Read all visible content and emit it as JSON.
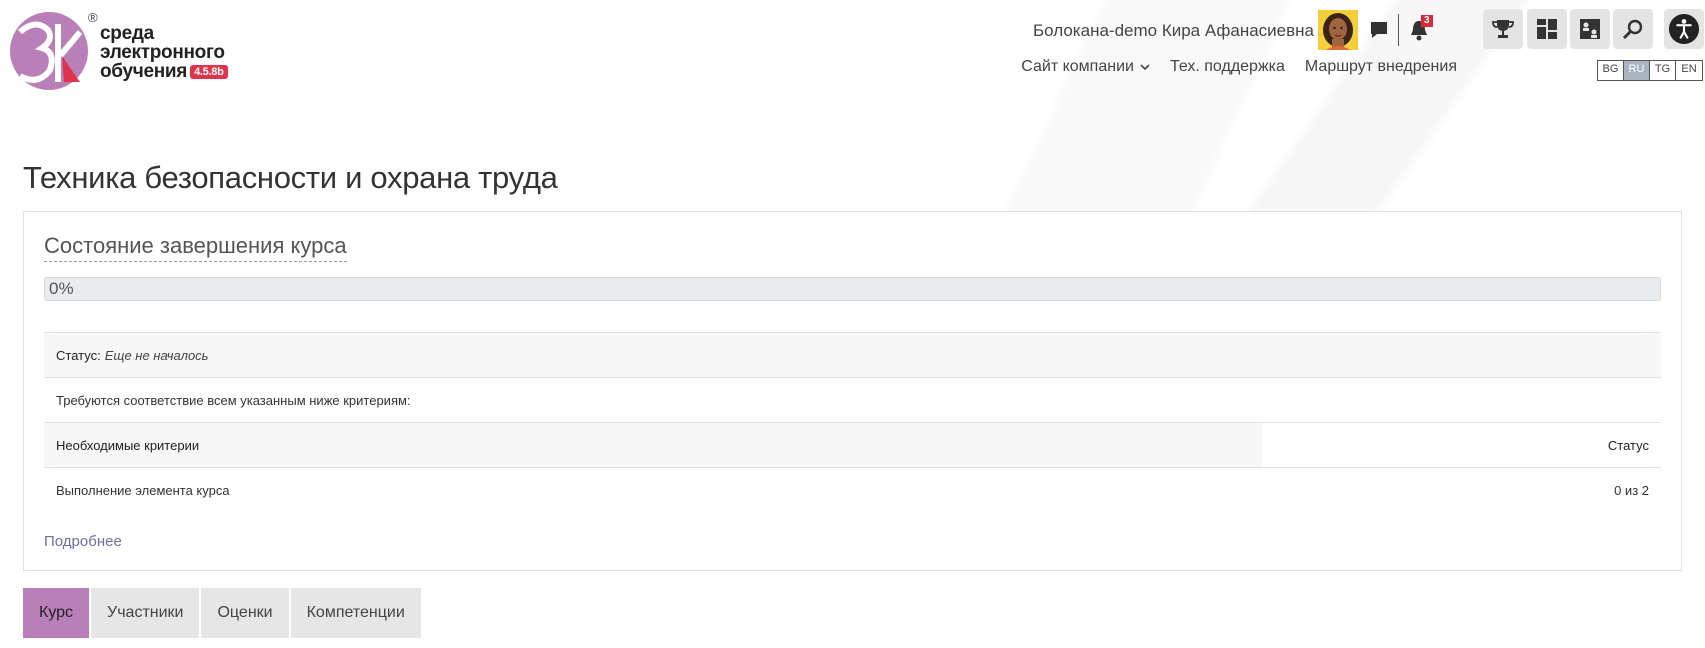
{
  "header": {
    "logo": {
      "mark_text": "3k",
      "line1": "среда",
      "line2": "электронного",
      "line3": "обучения",
      "version": "4.5.8b",
      "reg": "®"
    },
    "user_name": "Болокана-demo Кира Афанасиевна",
    "notifications_count": "3",
    "toolbar": [
      "trophy-icon",
      "dashboard-icon",
      "org-chart-icon",
      "search-icon",
      "accessibility-icon"
    ],
    "nav": {
      "company_site": "Сайт компании",
      "support": "Тех. поддержка",
      "route": "Маршрут внедрения"
    },
    "languages": [
      {
        "code": "BG",
        "active": false
      },
      {
        "code": "RU",
        "active": true
      },
      {
        "code": "TG",
        "active": false
      },
      {
        "code": "EN",
        "active": false
      }
    ]
  },
  "main": {
    "page_title": "Техника безопасности и охрана труда",
    "completion": {
      "title": "Состояние завершения курса",
      "progress_percent": 0,
      "progress_label": "0%",
      "status_label": "Статус:",
      "status_value": "Еще не началось",
      "criteria_note": "Требуются соответствие всем указанным ниже критериям:",
      "table_header_left": "Необходимые критерии",
      "table_header_right": "Статус",
      "rows": [
        {
          "criterion": "Выполнение элемента курса",
          "status": "0 из 2"
        }
      ],
      "more_link": "Подробнее"
    },
    "tabs": [
      {
        "label": "Курс",
        "active": true
      },
      {
        "label": "Участники",
        "active": false
      },
      {
        "label": "Оценки",
        "active": false
      },
      {
        "label": "Компетенции",
        "active": false
      }
    ]
  },
  "colors": {
    "accent": "#b97fb8",
    "badge": "#d62b3d",
    "logo_red": "#e0334c"
  }
}
